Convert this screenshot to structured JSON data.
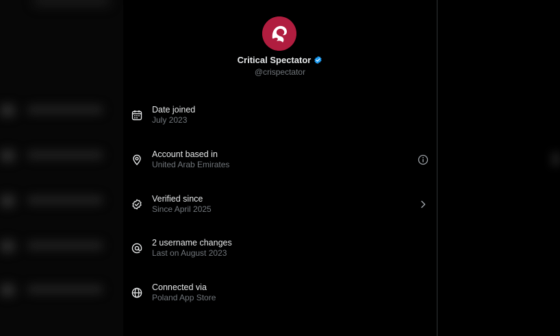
{
  "profile": {
    "display_name": "Critical Spectator",
    "handle": "@crispectator",
    "verified": true,
    "avatar_color": "#b01d3f",
    "verified_badge_color": "#1d9bf0"
  },
  "about_rows": [
    {
      "title": "Date joined",
      "value": "July 2023",
      "icon": "calendar-icon"
    },
    {
      "title": "Account based in",
      "value": "United Arab Emirates",
      "icon": "location-pin-icon",
      "trailing_icon": "info-icon"
    },
    {
      "title": "Verified since",
      "value": "Since April 2025",
      "icon": "verified-check-icon",
      "trailing_icon": "chevron-right-icon"
    },
    {
      "title": "2 username changes",
      "value": "Last on August 2023",
      "icon": "at-sign-icon"
    },
    {
      "title": "Connected via",
      "value": "Poland App Store",
      "icon": "globe-icon"
    }
  ],
  "colors": {
    "background": "#000000",
    "primary_text": "#e7e9ea",
    "secondary_text": "#71767b",
    "divider": "#2f3336"
  }
}
